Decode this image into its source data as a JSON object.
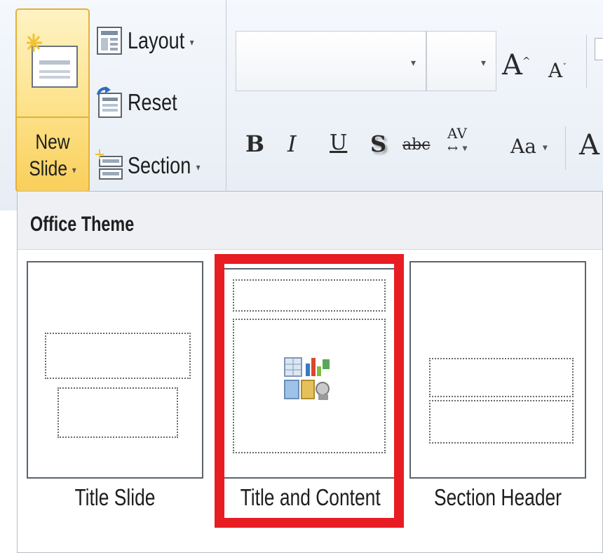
{
  "ribbon": {
    "new_slide": {
      "line1": "New",
      "line2": "Slide",
      "caret": "▾"
    },
    "slide_commands": [
      {
        "label": "Layout",
        "caret": "▾",
        "icon": "layout-icon"
      },
      {
        "label": "Reset",
        "caret": "",
        "icon": "reset-icon"
      },
      {
        "label": "Section",
        "caret": "▾",
        "icon": "section-icon"
      }
    ],
    "font": {
      "name_value": "",
      "size_value": "",
      "dropdown_caret": "▾",
      "grow_glyph": "A",
      "shrink_glyph": "A",
      "bold": "B",
      "italic": "I",
      "underline": "U",
      "shadow": "S",
      "strikethrough": "abc",
      "spacing": "AV",
      "change_case": "Aa",
      "clear_glyph": "A"
    }
  },
  "gallery": {
    "title": "Office Theme",
    "layouts": [
      {
        "label": "Title Slide"
      },
      {
        "label": "Title and Content"
      },
      {
        "label": "Section Header"
      }
    ]
  },
  "colors": {
    "highlight": "#e81c23",
    "button_active": "#fde28a",
    "button_border": "#e3b03f"
  }
}
